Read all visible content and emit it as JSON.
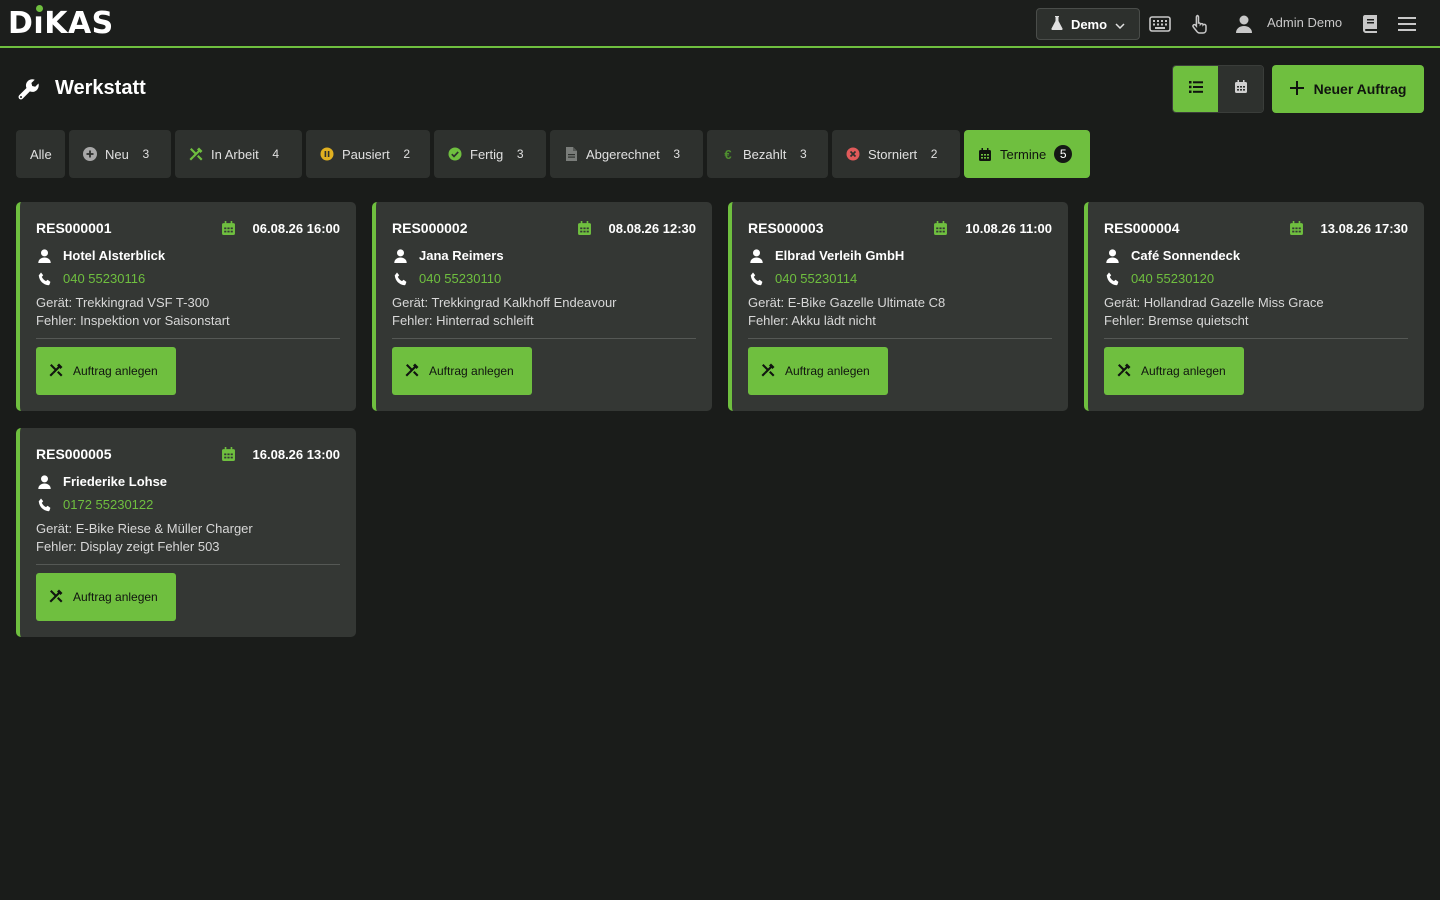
{
  "app": {
    "logo_text": "DIKAS"
  },
  "topbar": {
    "demo_label": "Demo",
    "user_name": "Admin Demo"
  },
  "page": {
    "title": "Werkstatt",
    "new_order_label": "Neuer Auftrag"
  },
  "filters": [
    {
      "label": "Alle",
      "count": null,
      "icon": "none"
    },
    {
      "label": "Neu",
      "count": "3",
      "icon": "plus-circle-icon"
    },
    {
      "label": "In Arbeit",
      "count": "4",
      "icon": "tools-icon"
    },
    {
      "label": "Pausiert",
      "count": "2",
      "icon": "pause-circle-icon"
    },
    {
      "label": "Fertig",
      "count": "3",
      "icon": "check-circle-icon"
    },
    {
      "label": "Abgerechnet",
      "count": "3",
      "icon": "document-icon"
    },
    {
      "label": "Bezahlt",
      "count": "3",
      "icon": "euro-icon"
    },
    {
      "label": "Storniert",
      "count": "2",
      "icon": "x-circle-icon"
    },
    {
      "label": "Termine",
      "count": "5",
      "icon": "calendar-icon"
    }
  ],
  "cards": [
    {
      "id": "RES000001",
      "date": "06.08.26 16:00",
      "customer": "Hotel Alsterblick",
      "phone": "040 55230116",
      "device": "Gerät: Trekkingrad VSF T-300",
      "fault": "Fehler: Inspektion vor Saisonstart",
      "button": "Auftrag anlegen"
    },
    {
      "id": "RES000002",
      "date": "08.08.26 12:30",
      "customer": "Jana Reimers",
      "phone": "040 55230110",
      "device": "Gerät: Trekkingrad Kalkhoff Endeavour",
      "fault": "Fehler: Hinterrad schleift",
      "button": "Auftrag anlegen"
    },
    {
      "id": "RES000003",
      "date": "10.08.26 11:00",
      "customer": "Elbrad Verleih GmbH",
      "phone": "040 55230114",
      "device": "Gerät: E-Bike Gazelle Ultimate C8",
      "fault": "Fehler: Akku lädt nicht",
      "button": "Auftrag anlegen"
    },
    {
      "id": "RES000004",
      "date": "13.08.26 17:30",
      "customer": "Café Sonnendeck",
      "phone": "040 55230120",
      "device": "Gerät: Hollandrad Gazelle Miss Grace",
      "fault": "Fehler: Bremse quietscht",
      "button": "Auftrag anlegen"
    },
    {
      "id": "RES000005",
      "date": "16.08.26 13:00",
      "customer": "Friederike Lohse",
      "phone": "0172 55230122",
      "device": "Gerät: E-Bike Riese & Müller Charger",
      "fault": "Fehler: Display zeigt Fehler 503",
      "button": "Auftrag anlegen"
    }
  ],
  "colors": {
    "accent": "#6fbf3f",
    "background": "#1a1c1a",
    "card": "#343734"
  }
}
